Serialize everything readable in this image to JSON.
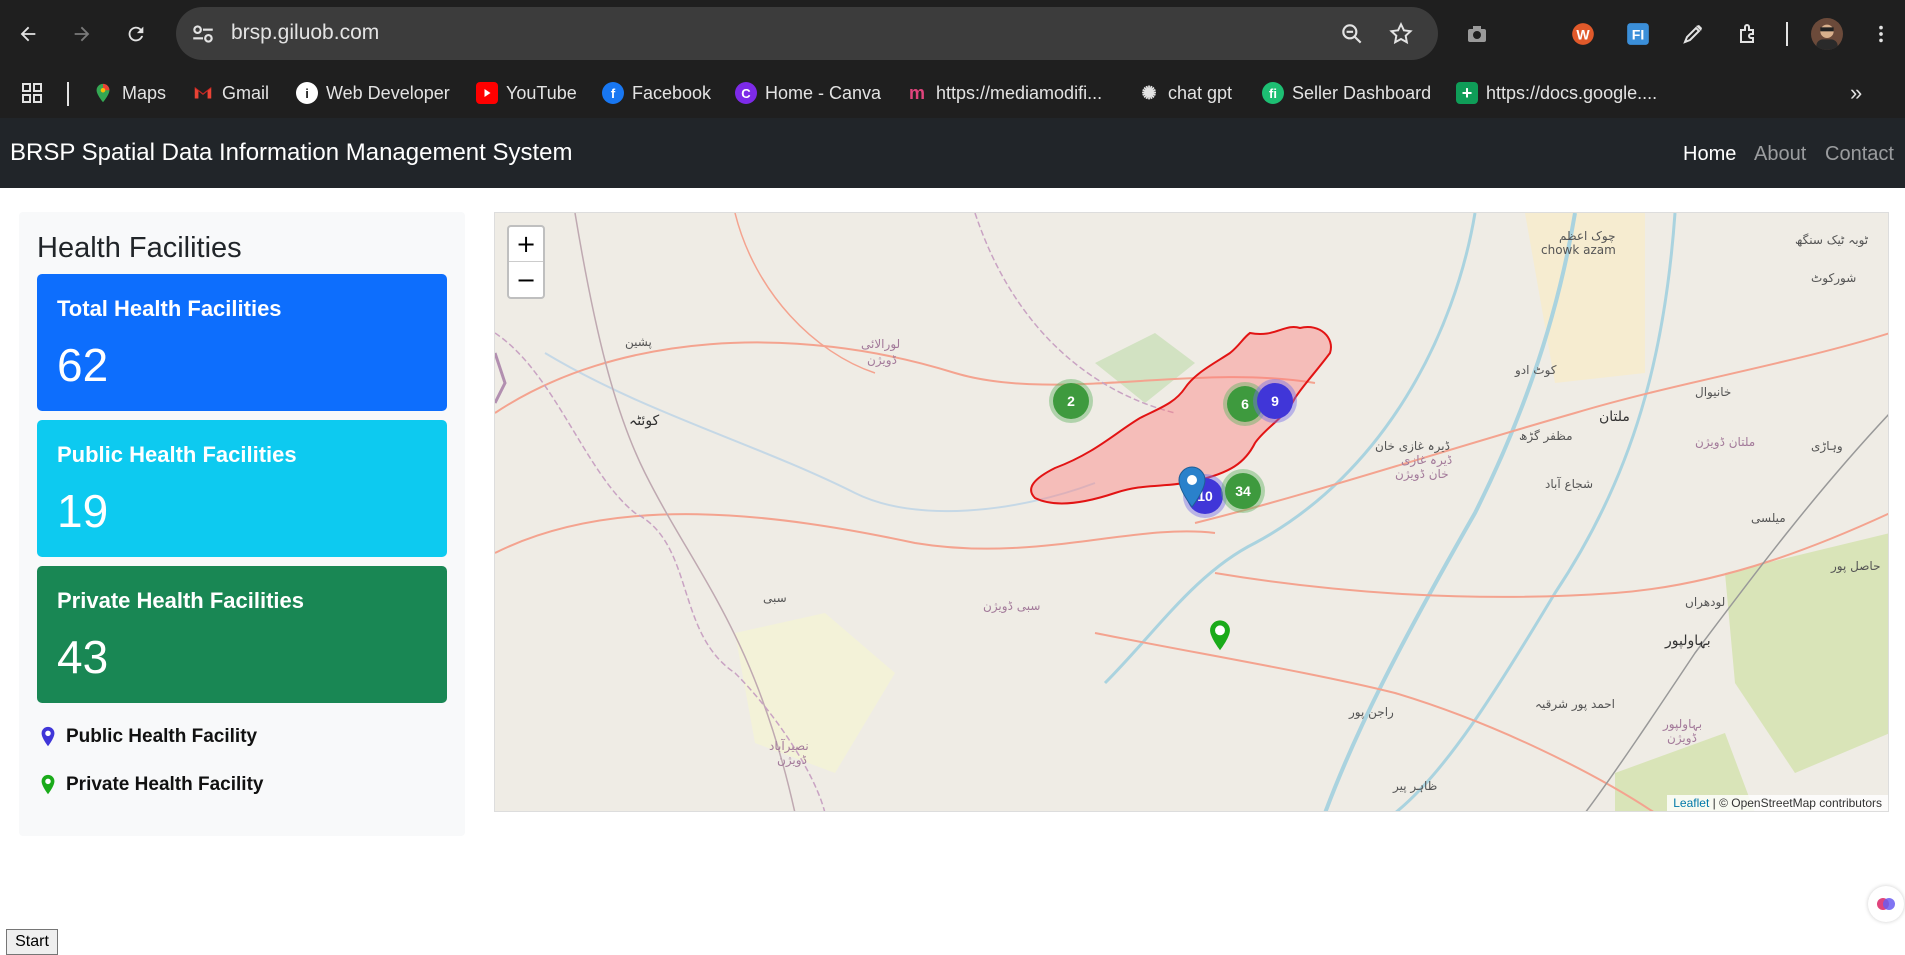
{
  "browser": {
    "url": "brsp.giluob.com",
    "bookmarks": [
      {
        "label": "Maps",
        "icon": "google-maps-icon"
      },
      {
        "label": "Gmail",
        "icon": "gmail-icon"
      },
      {
        "label": "Web Developer",
        "icon": "info-icon"
      },
      {
        "label": "YouTube",
        "icon": "youtube-icon"
      },
      {
        "label": "Facebook",
        "icon": "facebook-icon"
      },
      {
        "label": "Home - Canva",
        "icon": "canva-icon"
      },
      {
        "label": "https://mediamodifi...",
        "icon": "meta-icon"
      },
      {
        "label": "chat gpt",
        "icon": "openai-icon"
      },
      {
        "label": "Seller Dashboard",
        "icon": "fiverr-icon"
      },
      {
        "label": "https://docs.google....",
        "icon": "google-sheets-icon"
      }
    ]
  },
  "navbar": {
    "brand": "BRSP Spatial Data Information Management System",
    "links": [
      "Home",
      "About",
      "Contact"
    ]
  },
  "sidebar": {
    "title": "Health Facilities",
    "cards": {
      "total": {
        "title": "Total Health Facilities",
        "value": "62"
      },
      "public": {
        "title": "Public Health Facilities",
        "value": "19"
      },
      "private": {
        "title": "Private Health Facilities",
        "value": "43"
      }
    },
    "legend": {
      "public": "Public Health Facility",
      "private": "Private Health Facility"
    },
    "colors": {
      "total": "#0d6efd",
      "public": "#0dcaf0",
      "private": "#198754",
      "public_marker": "#4036d8",
      "private_marker": "#1aab1a"
    }
  },
  "map": {
    "zoom_in": "+",
    "zoom_out": "−",
    "clusters": [
      {
        "count": "2",
        "kind": "green"
      },
      {
        "count": "6",
        "kind": "green"
      },
      {
        "count": "9",
        "kind": "blue"
      },
      {
        "count": "10",
        "kind": "blue"
      },
      {
        "count": "34",
        "kind": "green"
      }
    ],
    "labels": {
      "chowk_azam_ur": "چوک اعظم",
      "chowk_azam": "chowk azam",
      "shorkot": "شورکوٹ",
      "toba": "ٹوبہ ٹیک سنگھ",
      "pishin": "پشین",
      "loralai": "لورالائی",
      "loralai_div": "ڈویژن",
      "quetta": "کوئٹہ",
      "kot_addu": "کوٹ ادو",
      "khanewal": "خانیوال",
      "multan": "ملتان",
      "dera_ghazi": "ڈیرہ غازی خان",
      "dgk_div": "ڈیرہ غازی",
      "dgk_div2": "خان ڈویژن",
      "muzaffargarh": "مظفر گڑھ",
      "vehari": "وہاڑی",
      "multan_div": "ملتان ڈویژن",
      "shujabad": "شجاع آباد",
      "mailsi": "میلسی",
      "hasilpur": "حاصل پور",
      "lodhran": "لودھراں",
      "sibi": "سبی",
      "sibi_div": "سبی ڈویژن",
      "bahawalpur": "بہاولپور",
      "ahmadpur": "احمد پور شرقیہ",
      "rajanpur": "راجن پور",
      "bahawalpur_div": "بہاولپور",
      "bahawalpur_div2": "ڈویژن",
      "naseerabad": "نصیرآباد",
      "naseerabad_div": "ڈویژن",
      "tahirpur": "ظاہر پیر"
    },
    "attribution_link": "Leaflet",
    "attribution_text": " | © OpenStreetMap contributors"
  },
  "footer": {
    "start": "Start"
  }
}
